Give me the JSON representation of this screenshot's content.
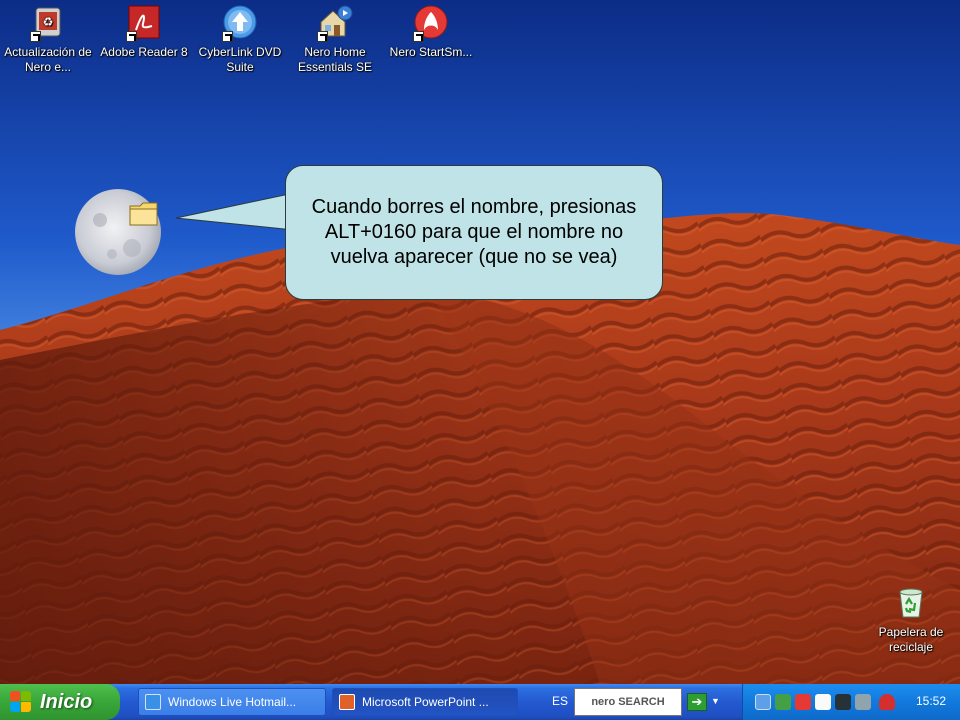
{
  "desktop": {
    "icons": [
      {
        "name": "nero-update-icon",
        "label": "Actualización de Nero e...",
        "color": "#c0392b"
      },
      {
        "name": "adobe-reader-icon",
        "label": "Adobe Reader 8",
        "color": "#d32f2f"
      },
      {
        "name": "cyberlink-dvd-icon",
        "label": "CyberLink DVD Suite",
        "color": "#3b8fe0"
      },
      {
        "name": "nero-home-icon",
        "label": "Nero Home Essentials SE",
        "color": "#8a7a5a"
      },
      {
        "name": "nero-startsmart-icon",
        "label": "Nero StartSm...",
        "color": "#e53935"
      }
    ],
    "recycle_bin": {
      "label": "Papelera de reciclaje"
    },
    "folder": {
      "label": ""
    }
  },
  "bubble": {
    "text": "Cuando borres el nombre, presionas ALT+0160 para que el nombre no vuelva aparecer (que no se vea)"
  },
  "taskbar": {
    "start_label": "Inicio",
    "tasks": [
      {
        "label": "Windows Live Hotmail...",
        "icon": "ie-icon"
      },
      {
        "label": "Microsoft PowerPoint ...",
        "icon": "powerpoint-icon"
      }
    ],
    "language": "ES",
    "search_label": "nero SEARCH",
    "clock": "15:52"
  }
}
